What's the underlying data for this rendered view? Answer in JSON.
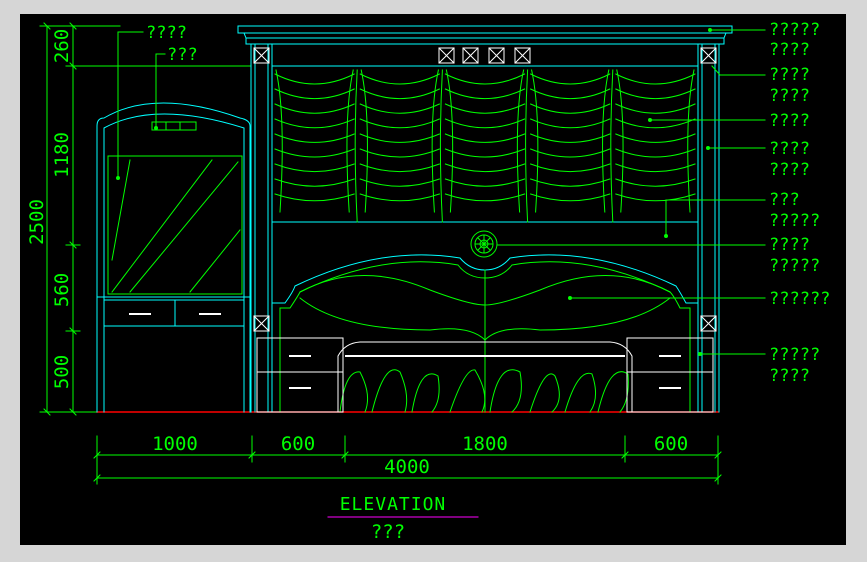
{
  "colors": {
    "background": "#000000",
    "frame": "#d6d6d6",
    "line_green": "#00ff00",
    "line_cyan": "#00ffff",
    "line_white": "#ffffff",
    "floor_red": "#ff0000",
    "underline_magenta": "#ff00ff"
  },
  "vertical_dimensions": {
    "total": "2500",
    "segments": [
      "260",
      "1180",
      "560",
      "500"
    ]
  },
  "horizontal_dimensions": {
    "segments": [
      "1000",
      "600",
      "1800",
      "600"
    ],
    "total": "4000"
  },
  "title": {
    "main": "ELEVATION",
    "sub": "???"
  },
  "callouts": {
    "left": [
      "????",
      "???"
    ],
    "right": [
      [
        "?????",
        "????"
      ],
      [
        "????",
        "????"
      ],
      [
        "????"
      ],
      [
        "????",
        "????"
      ],
      [
        "???",
        "?????"
      ],
      [
        "????",
        "?????"
      ],
      [
        "??????"
      ],
      [
        "?????",
        "????"
      ]
    ]
  },
  "icons": {
    "cross_box": "cross-box-icon",
    "rosette": "rosette-icon"
  }
}
